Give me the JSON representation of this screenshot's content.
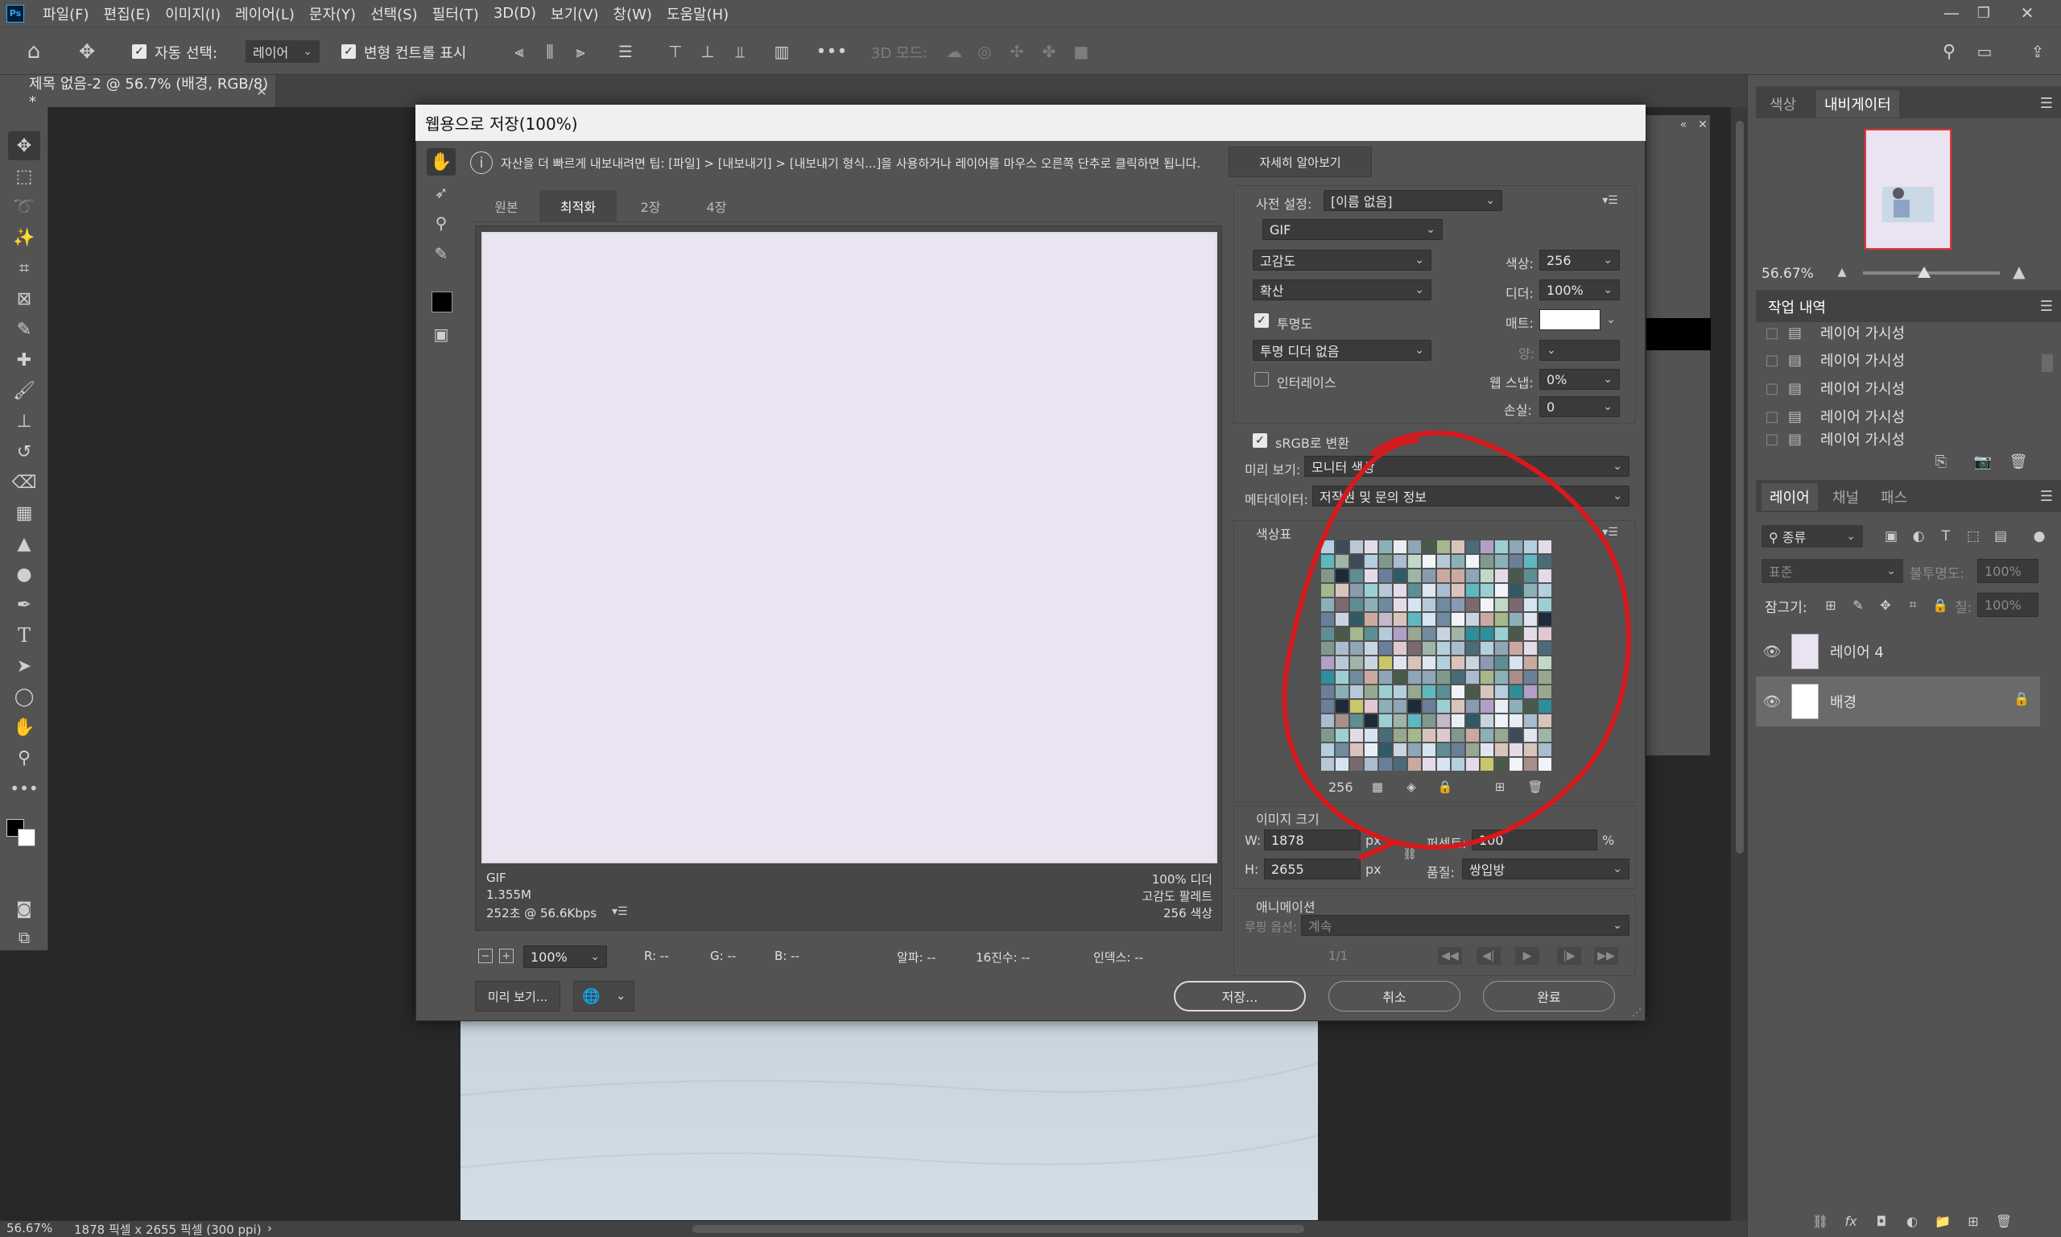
{
  "app": {
    "logo": "Ps"
  },
  "menu": [
    "파일(F)",
    "편집(E)",
    "이미지(I)",
    "레이어(L)",
    "문자(Y)",
    "선택(S)",
    "필터(T)",
    "3D(D)",
    "보기(V)",
    "창(W)",
    "도움말(H)"
  ],
  "options": {
    "auto_select_label": "자동 선택:",
    "auto_select_target": "레이어",
    "transform_controls_label": "변형 컨트롤 표시",
    "mode_3d_label": "3D 모드:"
  },
  "document": {
    "tab_title": "제목 없음-2 @ 56.7% (배경, RGB/8) *",
    "status_zoom": "56.67%",
    "status_info": "1878 픽셀 x 2655 픽셀 (300 ppi)"
  },
  "dialog": {
    "title": "웹용으로 저장(100%)",
    "info_text": "자산을 더 빠르게 내보내려면 팁: [파일] > [내보내기] > [내보내기 형식...]을 사용하거나 레이어를 마우스 오른쪽 단추로 클릭하면 됩니다.",
    "learn_more": "자세히 알아보기",
    "view_tabs": [
      "원본",
      "최적화",
      "2장",
      "4장"
    ],
    "preview_color": "#e9e3f2",
    "preview_info": {
      "format": "GIF",
      "size": "1.355M",
      "time": "252초 @ 56.6Kbps",
      "dither": "100% 디더",
      "palette": "고감도 팔레트",
      "colors": "256 색상"
    },
    "bottom_bar": {
      "zoom": "100%",
      "r": "R: --",
      "g": "G: --",
      "b": "B: --",
      "alpha": "알파: --",
      "hex": "16진수: --",
      "index": "인덱스: --"
    },
    "preview_button": "미리 보기...",
    "preset_label": "사전 설정:",
    "preset_value": "[이름 없음]",
    "format_value": "GIF",
    "reduction_value": "고감도",
    "colors_label": "색상:",
    "colors_value": "256",
    "dither_algo_value": "확산",
    "dither_label": "디더:",
    "dither_value": "100%",
    "transparency_label": "투명도",
    "matte_label": "매트:",
    "trans_dither_value": "투명 디더 없음",
    "amount_label": "양:",
    "interlace_label": "인터레이스",
    "websnap_label": "웹 스냅:",
    "websnap_value": "0%",
    "lossy_label": "손실:",
    "lossy_value": "0",
    "srgb_label": "sRGB로 변환",
    "preview_label": "미리 보기:",
    "preview_value": "모니터 색상",
    "metadata_label": "메타데이터:",
    "metadata_value": "저작권 및 문의 정보",
    "color_table_label": "색상표",
    "color_count": "256",
    "image_size": {
      "section_label": "이미지 크기",
      "w_label": "W:",
      "w_value": "1878",
      "h_label": "H:",
      "h_value": "2655",
      "unit": "px",
      "percent_label": "퍼센트:",
      "percent_value": "100",
      "percent_sign": "%",
      "quality_label": "품질:",
      "quality_value": "쌍입방"
    },
    "animation": {
      "section_label": "애니메이션",
      "loop_label": "루핑 옵션:",
      "loop_value": "계속",
      "frame": "1/1"
    },
    "buttons": {
      "save": "저장...",
      "cancel": "취소",
      "done": "완료"
    },
    "annotation_color": "#d7191c"
  },
  "right_panels": {
    "color_tabs": [
      "색상",
      "내비게이터"
    ],
    "navigator_zoom": "56.67%",
    "history_title": "작업 내역",
    "history_items": [
      "레이어 가시성",
      "레이어 가시성",
      "레이어 가시성",
      "레이어 가시성",
      "레이어 가시성"
    ],
    "layer_tabs": [
      "레이어",
      "채널",
      "패스"
    ],
    "filter_kind": "종류",
    "blend_mode": "표준",
    "opacity_label": "불투명도:",
    "opacity_value": "100%",
    "lock_label": "잠그기:",
    "fill_label": "칠:",
    "fill_value": "100%",
    "layers": [
      {
        "name": "레이어 4",
        "locked": false
      },
      {
        "name": "배경",
        "locked": true
      }
    ]
  }
}
